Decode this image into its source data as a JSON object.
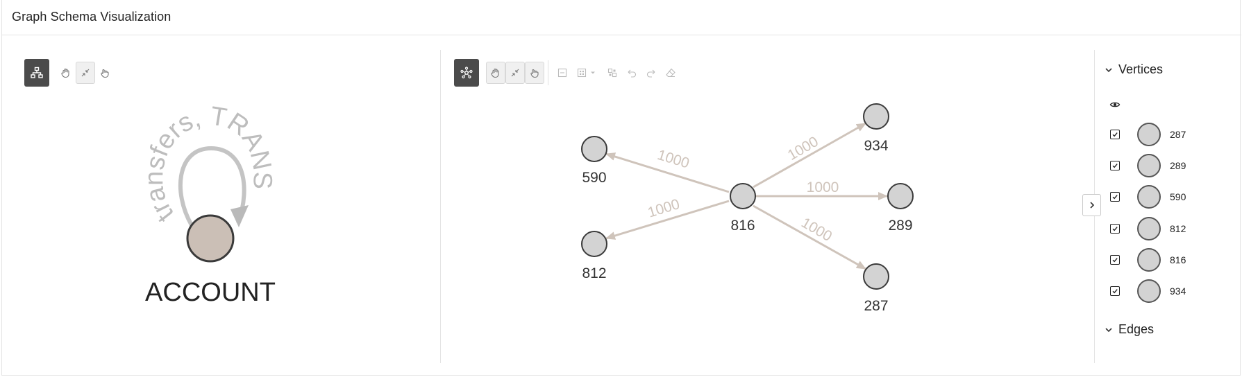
{
  "header": {
    "title": "Graph Schema Visualization"
  },
  "schema_panel": {
    "toolbar": [
      {
        "name": "schema-layout-button",
        "icon": "hierarchy-icon"
      },
      {
        "name": "pan-button",
        "icon": "hand-icon"
      },
      {
        "name": "fit-button",
        "icon": "collapse-arrows-icon"
      },
      {
        "name": "select-hand-button",
        "icon": "pointer-hand-icon"
      }
    ],
    "node_label": "ACCOUNT",
    "self_loop_label": "transfers, TRANS"
  },
  "graph_panel": {
    "toolbar": [
      {
        "name": "graph-layout-button",
        "icon": "star-network-icon"
      },
      {
        "name": "pan-button",
        "icon": "hand-icon"
      },
      {
        "name": "fit-button",
        "icon": "collapse-arrows-icon"
      },
      {
        "name": "select-hand-button",
        "icon": "pointer-hand-icon"
      },
      {
        "name": "collapse-button",
        "icon": "minus-box-icon"
      },
      {
        "name": "group-button",
        "icon": "grid-icon"
      },
      {
        "name": "group-dropdown",
        "icon": "caret-down-icon"
      },
      {
        "name": "ungroup-button",
        "icon": "ungroup-icon"
      },
      {
        "name": "undo-button",
        "icon": "undo-icon"
      },
      {
        "name": "redo-button",
        "icon": "redo-icon"
      },
      {
        "name": "clear-button",
        "icon": "eraser-icon"
      }
    ],
    "nodes": [
      {
        "id": "816",
        "label": "816"
      },
      {
        "id": "590",
        "label": "590"
      },
      {
        "id": "812",
        "label": "812"
      },
      {
        "id": "934",
        "label": "934"
      },
      {
        "id": "289",
        "label": "289"
      },
      {
        "id": "287",
        "label": "287"
      }
    ],
    "edges": [
      {
        "from": "816",
        "to": "590",
        "label": "1000"
      },
      {
        "from": "816",
        "to": "812",
        "label": "1000"
      },
      {
        "from": "816",
        "to": "934",
        "label": "1000"
      },
      {
        "from": "816",
        "to": "289",
        "label": "1000"
      },
      {
        "from": "816",
        "to": "287",
        "label": "1000"
      }
    ],
    "node_color": "#d3d3d3",
    "edge_color": "#cfc4bb"
  },
  "collapse_button": {
    "icon": "chevron-right-icon"
  },
  "side_panel": {
    "vertices_title": "Vertices",
    "visibility_icon": "eye-icon",
    "vertices": [
      {
        "label": "287",
        "checked": true
      },
      {
        "label": "289",
        "checked": true
      },
      {
        "label": "590",
        "checked": true
      },
      {
        "label": "812",
        "checked": true
      },
      {
        "label": "816",
        "checked": true
      },
      {
        "label": "934",
        "checked": true
      }
    ],
    "edges_title": "Edges"
  },
  "colors": {
    "account_node": "#cbbfb6",
    "toolbar_dark": "#4b4b4b"
  }
}
